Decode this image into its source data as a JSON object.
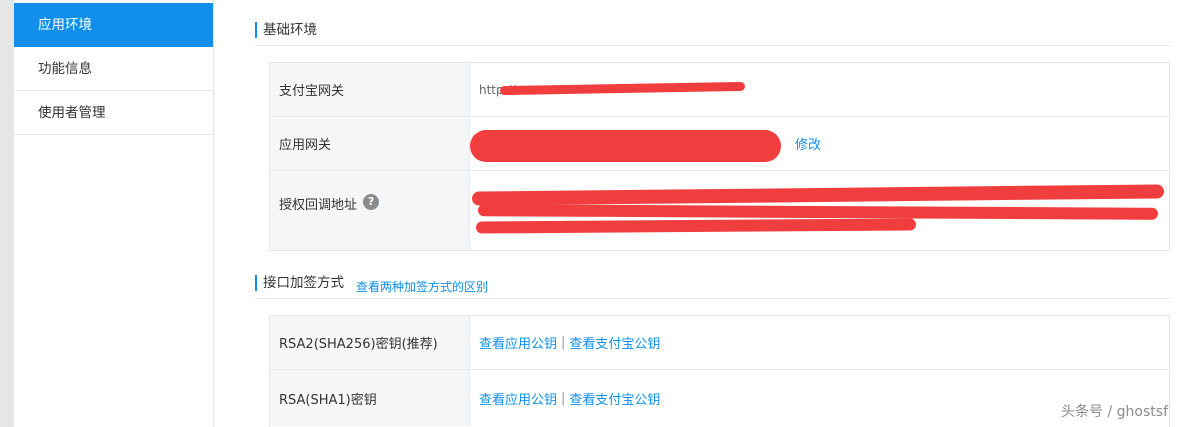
{
  "sidebar": {
    "items": [
      {
        "label": "应用环境",
        "active": true
      },
      {
        "label": "功能信息",
        "active": false
      },
      {
        "label": "使用者管理",
        "active": false
      }
    ]
  },
  "basic_env": {
    "title": "基础环境",
    "rows": [
      {
        "label": "支付宝网关",
        "value": "http://..."
      },
      {
        "label": "应用网关",
        "action": "修改"
      },
      {
        "label": "授权回调地址",
        "help": "?"
      }
    ]
  },
  "sign_method": {
    "title": "接口加签方式",
    "compare_link": "查看两种加签方式的区别",
    "rows": [
      {
        "label": "RSA2(SHA256)密钥(推荐)",
        "app_key_link": "查看应用公钥",
        "separator": "|",
        "alipay_key_link": "查看支付宝公钥"
      },
      {
        "label": "RSA(SHA1)密钥",
        "app_key_link": "查看应用公钥",
        "separator": "|",
        "alipay_key_link": "查看支付宝公钥"
      }
    ]
  },
  "watermark": "头条号 / ghostsf",
  "colors": {
    "accent": "#108ee9",
    "redaction": "#f03e3e"
  }
}
